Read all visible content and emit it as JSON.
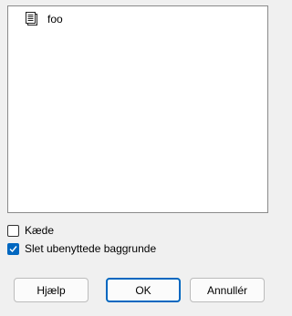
{
  "list": {
    "items": [
      {
        "label": "foo",
        "icon": "document-icon"
      }
    ]
  },
  "options": {
    "chain": {
      "label": "Kæde",
      "checked": false
    },
    "delete_unused_backgrounds": {
      "label": "Slet ubenyttede baggrunde",
      "checked": true
    }
  },
  "buttons": {
    "help_label": "Hjælp",
    "ok_label": "OK",
    "cancel_label": "Annullér"
  },
  "colors": {
    "accent": "#0067c0",
    "background": "#f0f0f0",
    "panel": "#ffffff"
  }
}
